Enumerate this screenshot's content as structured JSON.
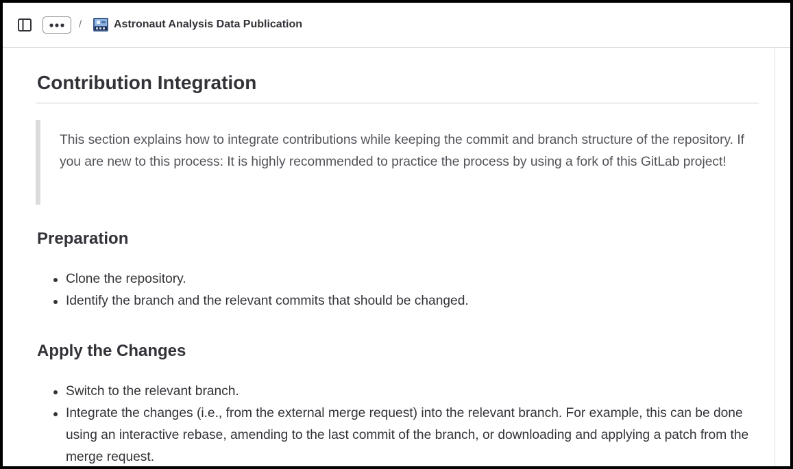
{
  "header": {
    "sidebar_toggle_icon": "sidebar-panel-icon",
    "more_icon": "ellipsis-icon",
    "separator": "/",
    "project_name": "Astronaut Analysis Data Publication"
  },
  "article": {
    "title": "Contribution Integration",
    "intro": "This section explains how to integrate contributions while keeping the commit and branch structure of the repository. If you are new to this process: It is highly recommended to practice the process by using a fork of this GitLab project!",
    "sections": [
      {
        "heading": "Preparation",
        "items": [
          "Clone the repository.",
          "Identify the branch and the relevant commits that should be changed."
        ]
      },
      {
        "heading": "Apply the Changes",
        "items": [
          "Switch to the relevant branch.",
          "Integrate the changes (i.e., from the external merge request) into the relevant branch. For example, this can be done using an interactive rebase, amending to the last commit of the branch, or downloading and applying a patch from the merge request."
        ]
      }
    ]
  },
  "colors": {
    "text": "#333238",
    "quote_text": "#535158",
    "border": "#dcdcde",
    "frame": "#000000"
  }
}
